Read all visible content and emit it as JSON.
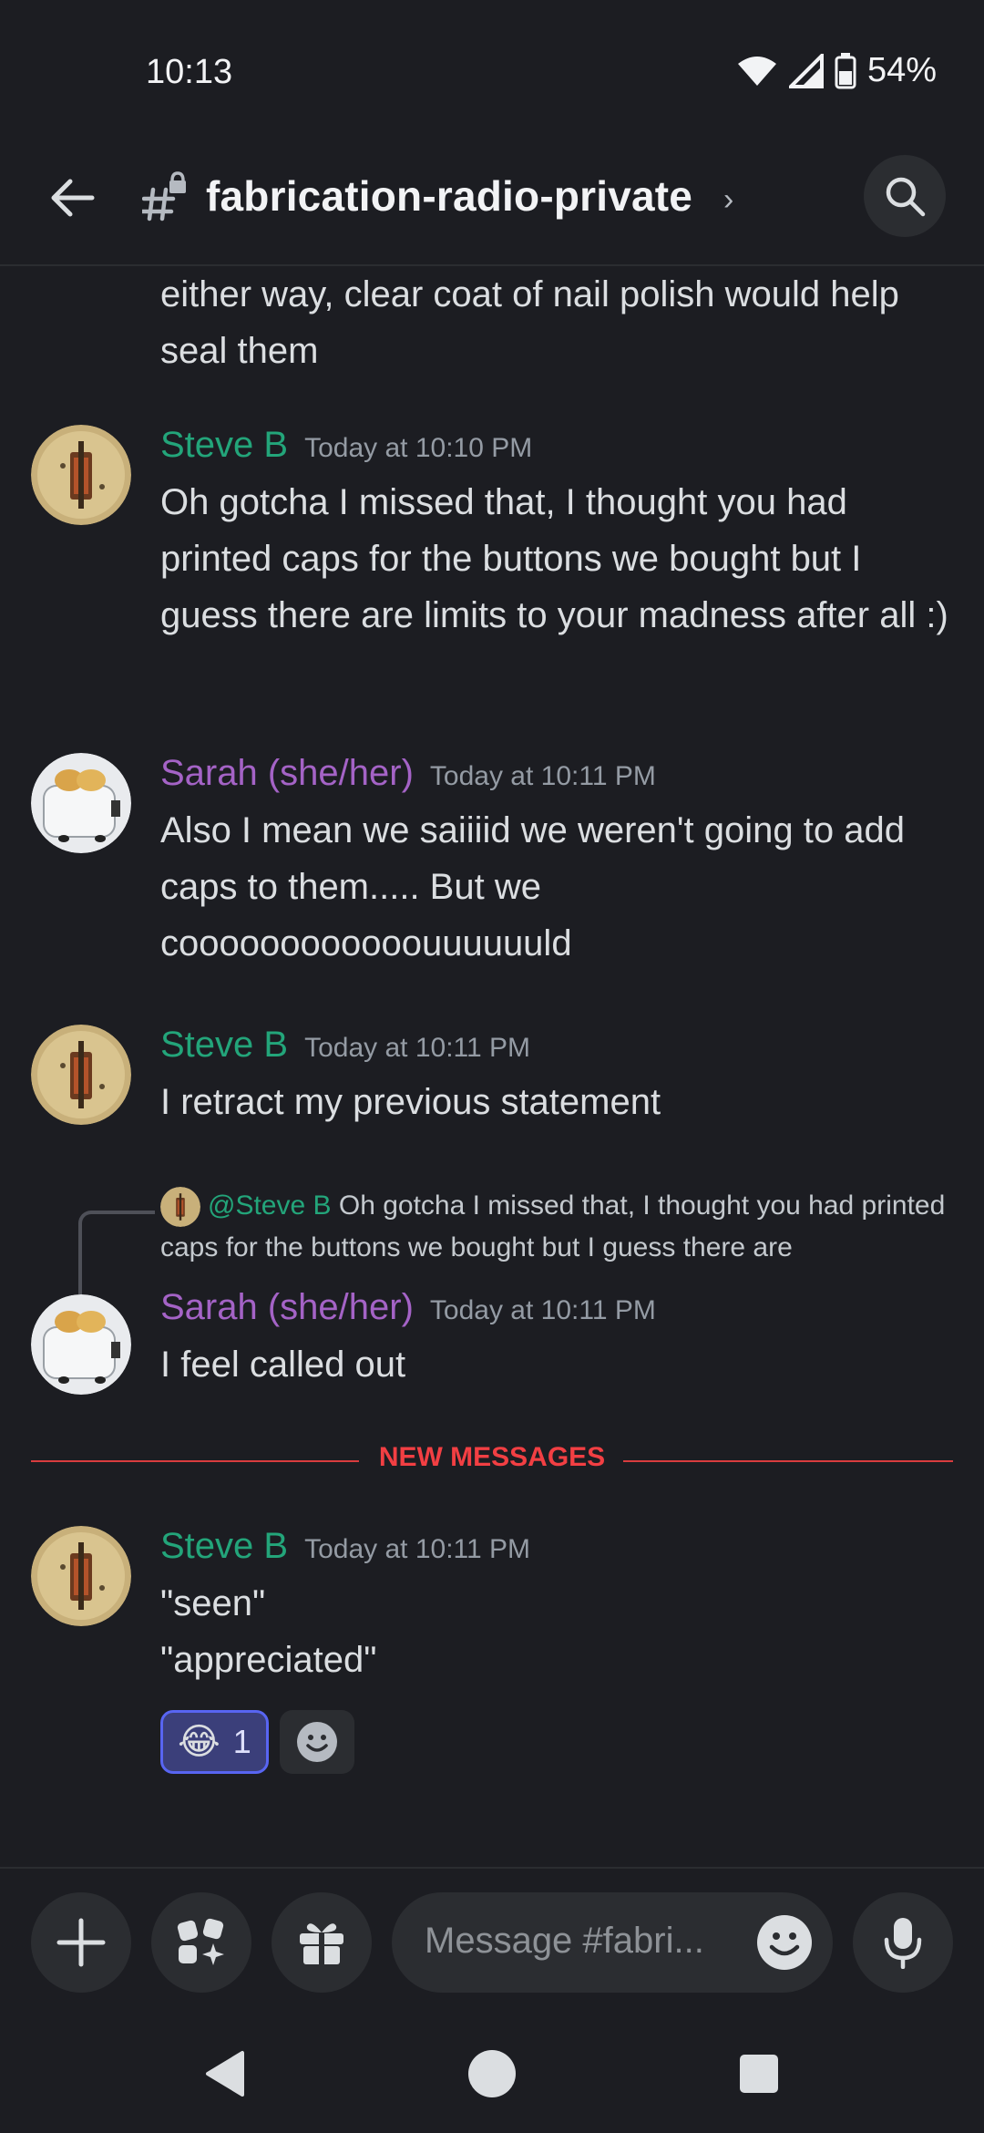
{
  "status": {
    "time": "10:13",
    "battery": "54%"
  },
  "header": {
    "channel_name": "fabrication-radio-private",
    "chevron": "›"
  },
  "messages": {
    "continuation": "either way, clear coat of nail polish would help seal them",
    "m1": {
      "author": "Steve B",
      "timestamp": "Today at 10:10 PM",
      "text": "Oh gotcha I missed that, I thought you had printed caps for the buttons we bought but I guess there are limits to your madness after all :)"
    },
    "m2": {
      "author": "Sarah (she/her)",
      "timestamp": "Today at 10:11 PM",
      "text": "Also I mean we saiiiid we weren't going to add caps to them..... But we coooooooooooouuuuuuld"
    },
    "m3": {
      "author": "Steve B",
      "timestamp": "Today at 10:11 PM",
      "text": "I retract my previous statement"
    },
    "m4": {
      "reply_author": "@Steve B",
      "reply_text": "Oh gotcha I missed that, I thought you had printed caps for the buttons we bought but I guess there are",
      "author": "Sarah (she/her)",
      "timestamp": "Today at 10:11 PM",
      "text": "I feel called out"
    },
    "divider": "NEW MESSAGES",
    "m5": {
      "author": "Steve B",
      "timestamp": "Today at 10:11 PM",
      "line1": "\"seen\"",
      "line2": "\"appreciated\"",
      "reaction_emoji": "😂",
      "reaction_count": "1"
    }
  },
  "composer": {
    "placeholder": "Message #fabri..."
  },
  "icons": {
    "back": "arrow-left-icon",
    "channel": "locked-hash-icon",
    "search": "search-icon",
    "plus": "plus-icon",
    "apps": "apps-icon",
    "gift": "gift-icon",
    "emoji": "smiley-icon",
    "mic": "microphone-icon"
  },
  "colors": {
    "background": "#1c1d22",
    "steve": "#23a57a",
    "sarah": "#a463c6",
    "new_messages": "#f23f43",
    "reaction_active": "#5865f2"
  }
}
